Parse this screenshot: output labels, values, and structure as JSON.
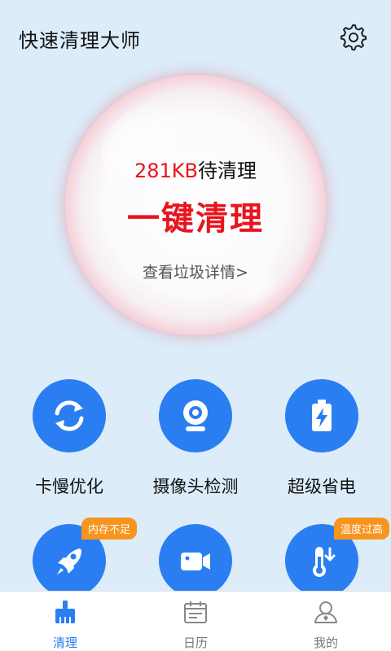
{
  "header": {
    "title": "快速清理大师",
    "settings_icon": "gear-icon"
  },
  "bubble": {
    "size_number": "281KB",
    "size_suffix": "待清理",
    "action": "一键清理",
    "link": "查看垃圾详情>"
  },
  "tools": [
    {
      "label": "卡慢优化",
      "icon": "refresh-icon"
    },
    {
      "label": "摄像头检测",
      "icon": "webcam-icon"
    },
    {
      "label": "超级省电",
      "icon": "battery-icon"
    },
    {
      "label": "",
      "icon": "rocket-icon",
      "tag": "内存不足"
    },
    {
      "label": "",
      "icon": "video-camera-icon"
    },
    {
      "label": "",
      "icon": "thermometer-icon",
      "tag": "温度过高"
    }
  ],
  "nav": {
    "items": [
      {
        "label": "清理",
        "icon": "broom-icon",
        "active": true
      },
      {
        "label": "日历",
        "icon": "calendar-icon",
        "active": false
      },
      {
        "label": "我的",
        "icon": "user-icon",
        "active": false
      }
    ]
  },
  "colors": {
    "background": "#dcecf9",
    "accent_blue": "#2a7ef2",
    "alert_red": "#e8141f",
    "tag_orange": "#f7951e"
  }
}
